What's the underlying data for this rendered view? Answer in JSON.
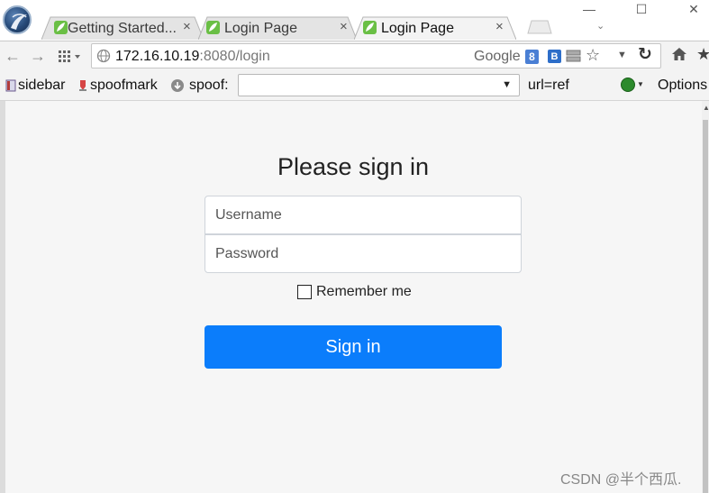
{
  "browser": {
    "tabs": [
      {
        "title": "Getting Started...",
        "close": "×",
        "active": false
      },
      {
        "title": "Login Page",
        "close": "×",
        "active": false
      },
      {
        "title": "Login Page",
        "close": "×",
        "active": true
      }
    ],
    "window_controls": {
      "minimize": "—",
      "maximize": "☐",
      "close": "✕"
    },
    "address_bar": {
      "host": "172.16.10.19",
      "rest": ":8080/login",
      "search_engine": "Google",
      "google_badge": "8",
      "b_badge": "B"
    },
    "bookmarks": {
      "sidebar": "sidebar",
      "spoofmark": "spoofmark",
      "spoof": "spoof:",
      "spoof_select_value": "",
      "url_ref": "url=ref",
      "options": "Options"
    },
    "icons": {
      "back": "arrow-left-icon",
      "forward": "arrow-right-icon",
      "apps": "apps-grid-icon",
      "reload": "reload-icon",
      "home": "home-icon",
      "star": "star-icon"
    }
  },
  "page": {
    "heading": "Please sign in",
    "username_placeholder": "Username",
    "password_placeholder": "Password",
    "remember_label": "Remember me",
    "signin_label": "Sign in"
  },
  "watermark": "CSDN @半个西瓜.",
  "colors": {
    "signin_button": "#0b7dfb",
    "favicon": "#6abf45",
    "page_bg": "#f6f6f6"
  }
}
